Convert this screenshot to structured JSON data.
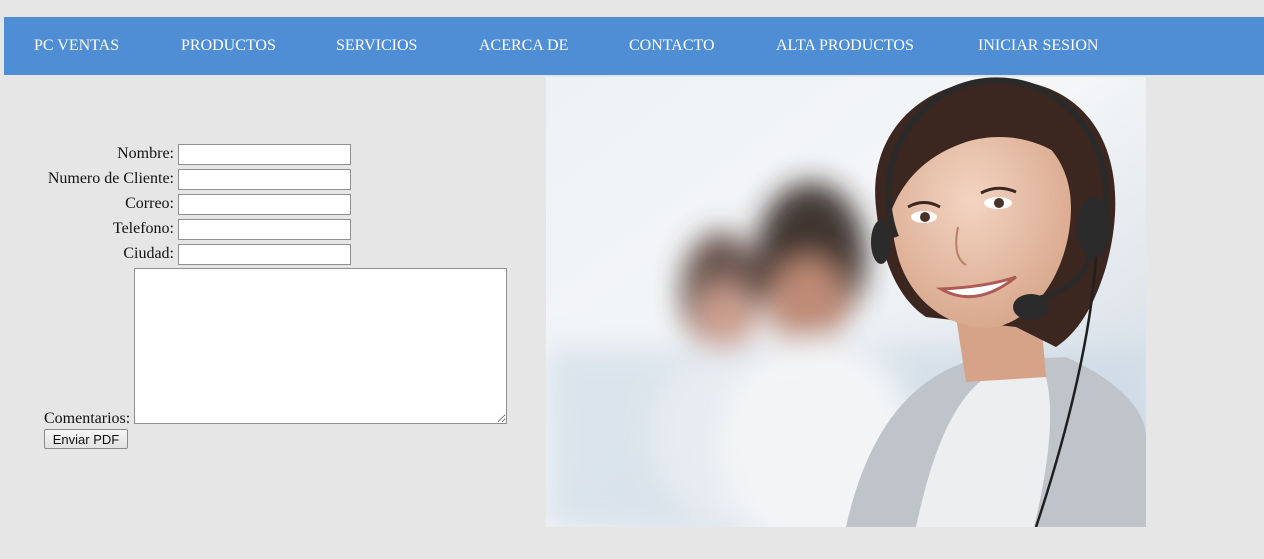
{
  "nav": {
    "items": [
      {
        "label": "PC VENTAS"
      },
      {
        "label": "PRODUCTOS"
      },
      {
        "label": "SERVICIOS"
      },
      {
        "label": "ACERCA DE"
      },
      {
        "label": "CONTACTO"
      },
      {
        "label": "ALTA PRODUCTOS"
      },
      {
        "label": "INICIAR SESION"
      }
    ]
  },
  "form": {
    "fields": [
      {
        "label": "Nombre:",
        "value": ""
      },
      {
        "label": "Numero de Cliente:",
        "value": ""
      },
      {
        "label": "Correo:",
        "value": ""
      },
      {
        "label": "Telefono:",
        "value": ""
      },
      {
        "label": "Ciudad:",
        "value": ""
      }
    ],
    "comments": {
      "label": "Comentarios:",
      "value": ""
    },
    "submit_label": "Enviar PDF"
  },
  "colors": {
    "page_bg": "#e6e6e6",
    "nav_bg": "#4f8dd5",
    "nav_text": "#ffffff"
  },
  "image": {
    "subject": "customer-service-agent-photo"
  }
}
